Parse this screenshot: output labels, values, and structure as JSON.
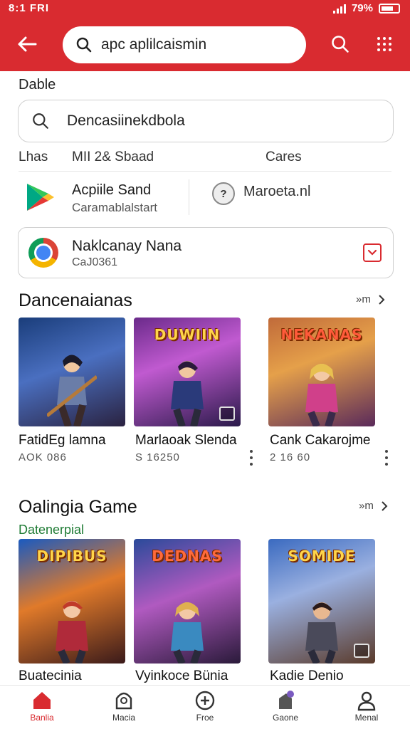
{
  "status_bar": {
    "time": "8:1 FRI",
    "battery": "79%"
  },
  "header": {
    "search_text": "apc aplilcaismin"
  },
  "section_label": "Dable",
  "search_box": {
    "value": "Dencasiinekdbola"
  },
  "filters": {
    "col1": "Lhas",
    "col2": "MII 2& Sbaad",
    "col3": "Cares"
  },
  "app_row": {
    "left_title": "Acpiile Sand",
    "left_subtitle": "Caramablalstart",
    "right_icon_text": "?",
    "right_title": "Maroeta.nl"
  },
  "featured": {
    "title": "Naklcanay Nana",
    "subtitle": "CaJ0361"
  },
  "section1": {
    "title": "Dancenaianas",
    "more": "»m",
    "games": [
      {
        "title": "FatidEg lamna",
        "meta": "AOK 086",
        "logo": ""
      },
      {
        "title": "Marlaoak Slenda",
        "meta": "S 16250",
        "logo": "DUWIIN"
      },
      {
        "title": "Cank Cakarojme",
        "meta": "2 16 60",
        "logo": "NEKANAS"
      }
    ]
  },
  "section2": {
    "title": "Oalingia Game",
    "subtitle": "Datenerpial",
    "more": "»m",
    "games": [
      {
        "title": "Buatecinia",
        "logo": "DIPIBUS"
      },
      {
        "title": "Vyinkoce Bünia",
        "logo": "DEDNAS"
      },
      {
        "title": "Kadie Denio",
        "logo": "SOMIDE"
      }
    ]
  },
  "nav": [
    {
      "label": "Banlia"
    },
    {
      "label": "Macia"
    },
    {
      "label": "Froe"
    },
    {
      "label": "Gaone"
    },
    {
      "label": "Menal"
    }
  ],
  "colors": {
    "brand": "#d92b30",
    "accent_green": "#1e7b34"
  },
  "icons": [
    "back-arrow-icon",
    "search-icon",
    "grid-dots-icon",
    "play-store-icon",
    "chrome-icon",
    "home-icon",
    "shield-icon",
    "plus-circle-icon",
    "bag-icon",
    "person-icon"
  ]
}
